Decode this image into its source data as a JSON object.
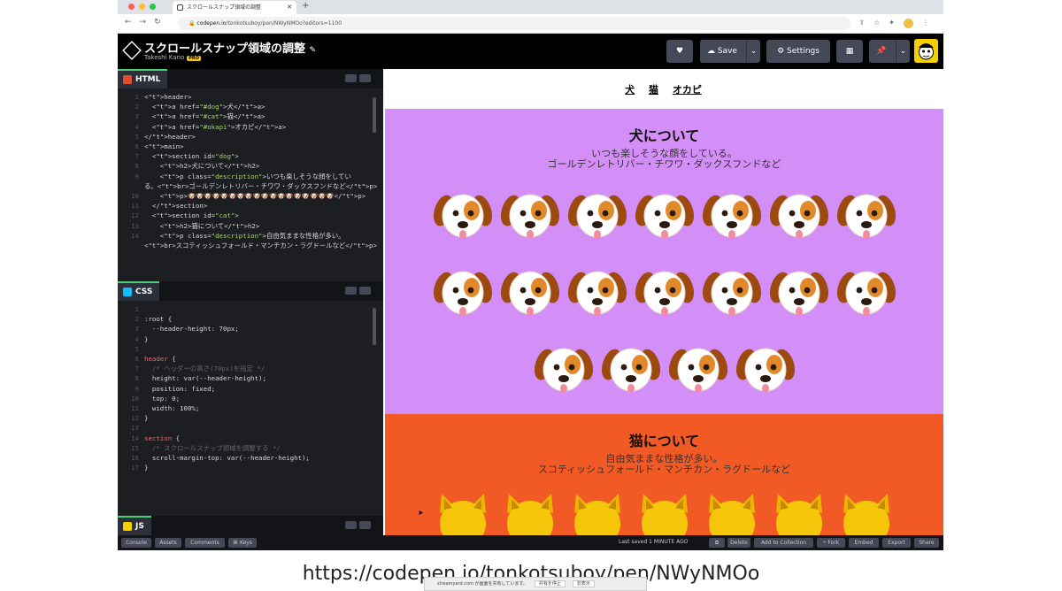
{
  "browser": {
    "tab_title": "スクロールスナップ領域の調整",
    "url_host": "codepen.io",
    "url_path": "/tonkotsuboy/pen/NWyNMOo?editors=1100"
  },
  "pen": {
    "title": "スクロールスナップ領域の調整",
    "author": "Takeshi Kano",
    "pro_badge": "PRO",
    "save_label": "Save",
    "settings_label": "Settings"
  },
  "panes": {
    "html_label": "HTML",
    "css_label": "CSS",
    "js_label": "JS"
  },
  "html_code": [
    {
      "n": "1",
      "text": "<header>"
    },
    {
      "n": "2",
      "text": "  <a href=\"#dog\">犬</a>"
    },
    {
      "n": "3",
      "text": "  <a href=\"#cat\">猫</a>"
    },
    {
      "n": "4",
      "text": "  <a href=\"#okapi\">オカピ</a>"
    },
    {
      "n": "5",
      "text": "</header>"
    },
    {
      "n": "6",
      "text": "<main>"
    },
    {
      "n": "7",
      "text": "  <section id=\"dog\">"
    },
    {
      "n": "8",
      "text": "    <h2>犬について</h2>"
    },
    {
      "n": "9",
      "text": "    <p class=\"description\">いつも楽しそうな顔をしてい"
    },
    {
      "n": "",
      "text": "る。<br>ゴールデンレトリバー・チワワ・ダックスフンドなど</p>"
    },
    {
      "n": "10",
      "text": "    <p>🐶🐶🐶🐶🐶🐶🐶🐶🐶🐶🐶🐶🐶🐶🐶🐶🐶🐶</p>"
    },
    {
      "n": "11",
      "text": "  </section>"
    },
    {
      "n": "12",
      "text": "  <section id=\"cat\">"
    },
    {
      "n": "13",
      "text": "    <h2>猫について</h2>"
    },
    {
      "n": "14",
      "text": "    <p class=\"description\">自由気ままな性格が多い。"
    },
    {
      "n": "",
      "text": "<br>スコティッシュフォールド・マンチカン・ラグドールなど</p>"
    }
  ],
  "css_code": [
    {
      "n": "1",
      "text": ""
    },
    {
      "n": "2",
      "text": ":root {"
    },
    {
      "n": "3",
      "text": "  --header-height: 70px;"
    },
    {
      "n": "4",
      "text": "}"
    },
    {
      "n": "5",
      "text": ""
    },
    {
      "n": "6",
      "text": "header {"
    },
    {
      "n": "7",
      "text": "  /* ヘッダーの高さ(70px)を指定 */"
    },
    {
      "n": "8",
      "text": "  height: var(--header-height);"
    },
    {
      "n": "9",
      "text": "  position: fixed;"
    },
    {
      "n": "10",
      "text": "  top: 0;"
    },
    {
      "n": "11",
      "text": "  width: 100%;"
    },
    {
      "n": "12",
      "text": "}"
    },
    {
      "n": "13",
      "text": ""
    },
    {
      "n": "14",
      "text": "section {"
    },
    {
      "n": "15",
      "text": "  /* スクロールスナップ領域を調整する */"
    },
    {
      "n": "16",
      "text": "  scroll-margin-top: var(--header-height);"
    },
    {
      "n": "17",
      "text": "}"
    }
  ],
  "footer": {
    "console": "Console",
    "assets": "Assets",
    "comments": "Comments",
    "keys": "⌘ Keys",
    "last_saved": "Last saved 1 MINUTE AGO",
    "delete": "Delete",
    "add_to_collection": "Add to Collection",
    "fork": "⑂ Fork",
    "embed": "Embed",
    "export": "Export",
    "share": "Share"
  },
  "preview": {
    "nav": [
      "犬",
      "猫",
      "オカピ"
    ],
    "dog_title": "犬について",
    "dog_desc1": "いつも楽しそうな顔をしている。",
    "dog_desc2": "ゴールデンレトリバー・チワワ・ダックスフンドなど",
    "cat_title": "猫について",
    "cat_desc1": "自由気ままな性格が多い。",
    "cat_desc2": "スコティッシュフォールド・マンチカン・ラグドールなど",
    "dog_rows": [
      7,
      7,
      4
    ],
    "cat_count": 7,
    "dog_bg": "#d48ef7",
    "cat_bg": "#f15a24"
  },
  "caption": "https://codepen.io/tonkotsuboy/pen/NWyNMOo",
  "toast": {
    "text": "streamyard.com が画面を共有しています。",
    "stop": "共有を停止",
    "hide": "非表示"
  }
}
